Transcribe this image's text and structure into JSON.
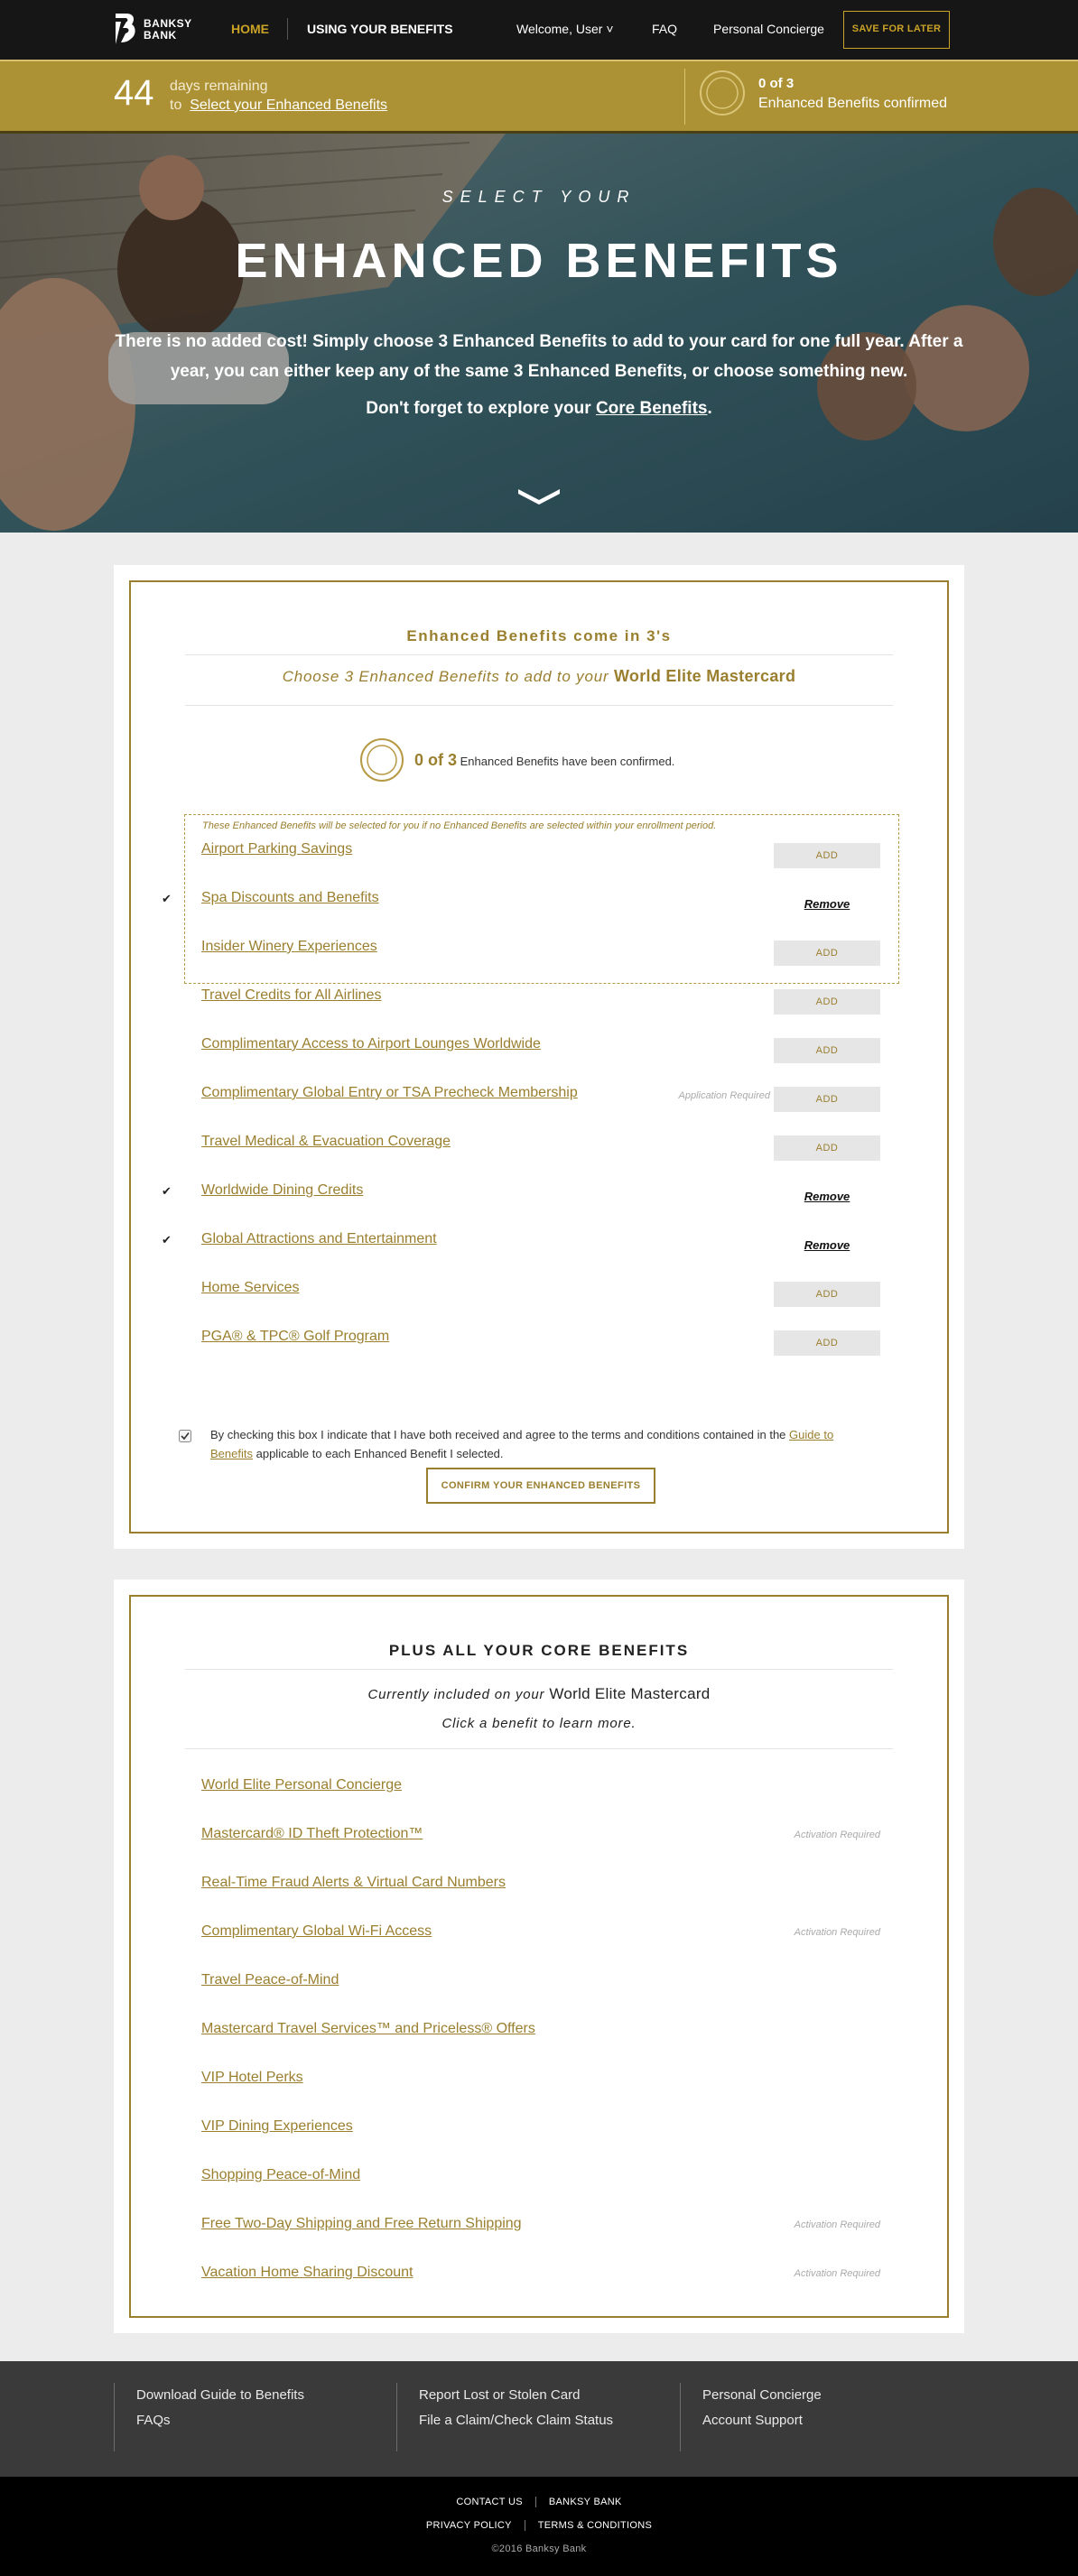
{
  "nav": {
    "logo_line1": "BANKSY",
    "logo_line2": "BANK",
    "home": "HOME",
    "using": "USING YOUR BENEFITS",
    "welcome": "Welcome, User ˅",
    "faq": "FAQ",
    "concierge": "Personal Concierge",
    "save": "SAVE FOR LATER"
  },
  "status": {
    "days": "44",
    "days_label": "days remaining",
    "to": "to",
    "select_link": "Select your Enhanced Benefits",
    "count": "0 of 3",
    "count_label": "Enhanced Benefits confirmed"
  },
  "hero": {
    "eyebrow": "SELECT YOUR",
    "title": "ENHANCED BENEFITS",
    "body": "There is no added cost! Simply choose 3 Enhanced Benefits to add to your card for one full year. After a year, you can either keep any of the same  3 Enhanced Benefits, or choose something new.",
    "sub_prefix": "Don't forget to explore your",
    "sub_link": "Core Benefits",
    "sub_suffix": "."
  },
  "enhanced": {
    "heading": "Enhanced Benefits come in 3's",
    "sub_prefix": "Choose 3 Enhanced Benefits to add to your",
    "card_name": "World Elite Mastercard",
    "confirm_count": "0 of 3",
    "confirm_text": "Enhanced Benefits have been confirmed.",
    "default_note": "These Enhanced Benefits will be selected for you if no Enhanced Benefits are selected within your enrollment period.",
    "add_label": "ADD",
    "remove_label": "Remove",
    "items": [
      {
        "label": "Airport Parking Savings",
        "selected": false,
        "note": ""
      },
      {
        "label": "Spa Discounts and Benefits",
        "selected": true,
        "note": ""
      },
      {
        "label": "Insider Winery Experiences",
        "selected": false,
        "note": ""
      },
      {
        "label": "Travel Credits for All Airlines",
        "selected": false,
        "note": ""
      },
      {
        "label": "Complimentary Access to Airport Lounges Worldwide",
        "selected": false,
        "note": ""
      },
      {
        "label": "Complimentary Global Entry or TSA Precheck Membership",
        "selected": false,
        "note": "Application Required"
      },
      {
        "label": "Travel Medical & Evacuation Coverage",
        "selected": false,
        "note": ""
      },
      {
        "label": "Worldwide Dining Credits",
        "selected": true,
        "note": ""
      },
      {
        "label": "Global Attractions and Entertainment",
        "selected": true,
        "note": ""
      },
      {
        "label": "Home Services",
        "selected": false,
        "note": ""
      },
      {
        "label": "PGA® & TPC® Golf Program",
        "selected": false,
        "note": ""
      }
    ],
    "terms_prefix": "By checking this box I indicate that I have both received and agree to the terms and conditions contained in the",
    "terms_link": "Guide to Benefits",
    "terms_suffix": "applicable to each Enhanced Benefit I selected.",
    "confirm_button": "CONFIRM YOUR ENHANCED BENEFITS"
  },
  "core": {
    "heading": "PLUS ALL YOUR CORE BENEFITS",
    "sub_prefix": "Currently included on your",
    "card_name": "World Elite Mastercard",
    "sub2": "Click a benefit to learn more.",
    "items": [
      {
        "label": "World Elite Personal Concierge",
        "note": ""
      },
      {
        "label": "Mastercard® ID Theft Protection™",
        "note": "Activation Required"
      },
      {
        "label": "Real-Time Fraud Alerts & Virtual Card Numbers",
        "note": ""
      },
      {
        "label": "Complimentary Global Wi-Fi Access",
        "note": "Activation Required"
      },
      {
        "label": "Travel Peace-of-Mind",
        "note": ""
      },
      {
        "label": "Mastercard Travel Services™ and Priceless® Offers",
        "note": ""
      },
      {
        "label": "VIP Hotel Perks",
        "note": ""
      },
      {
        "label": "VIP Dining Experiences",
        "note": ""
      },
      {
        "label": "Shopping Peace-of-Mind",
        "note": ""
      },
      {
        "label": "Free Two-Day Shipping and Free Return Shipping",
        "note": "Activation Required"
      },
      {
        "label": "Vacation Home Sharing Discount",
        "note": "Activation Required"
      }
    ]
  },
  "footer": {
    "col1": [
      "Download Guide to Benefits",
      "FAQs"
    ],
    "col2": [
      "Report Lost or Stolen Card",
      "File a Claim/Check Claim Status"
    ],
    "col3": [
      "Personal Concierge",
      "Account Support"
    ],
    "contact": "CONTACT US",
    "bank": "BANKSY BANK",
    "privacy": "PRIVACY POLICY",
    "terms": "TERMS & CONDITIONS",
    "copyright": "©2016 Banksy Bank"
  },
  "colors": {
    "gold": "#9a7f2f",
    "nav_gold": "#c9a227",
    "status_bar": "#ad9235",
    "dark": "#161616"
  }
}
